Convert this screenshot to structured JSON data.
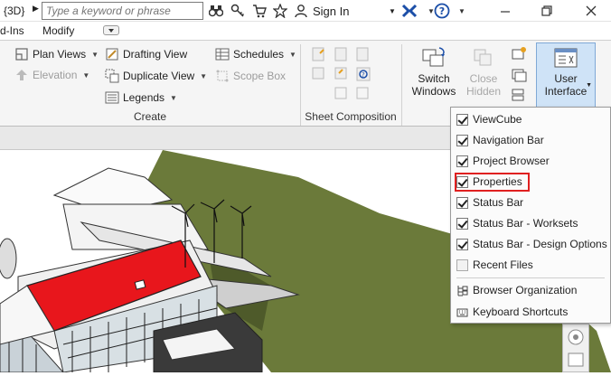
{
  "titlebar": {
    "view_name": "{3D}",
    "search_placeholder": "Type a keyword or phrase",
    "sign_in": "Sign In"
  },
  "tabs": [
    {
      "label": "d-Ins"
    },
    {
      "label": "Modify"
    }
  ],
  "ribbon": {
    "create_panel": {
      "title": "Create",
      "plan_views": "Plan Views",
      "elevation": "Elevation",
      "drafting_view": "Drafting View",
      "duplicate_view": "Duplicate View",
      "legends": "Legends",
      "schedules": "Schedules",
      "scope_box": "Scope Box"
    },
    "sheet_panel": {
      "title": "Sheet Composition"
    },
    "windows_panel": {
      "switch_windows": [
        "Switch",
        "Windows"
      ],
      "close_hidden": [
        "Close",
        "Hidden"
      ],
      "user_interface": [
        "User",
        "Interface"
      ]
    }
  },
  "user_interface_menu": {
    "items": [
      {
        "label": "ViewCube",
        "checked": true
      },
      {
        "label": "Navigation Bar",
        "checked": true
      },
      {
        "label": "Project Browser",
        "checked": true
      },
      {
        "label": "Properties",
        "checked": true
      },
      {
        "label": "Status Bar",
        "checked": true
      },
      {
        "label": "Status Bar - Worksets",
        "checked": true
      },
      {
        "label": "Status Bar - Design Options",
        "checked": true
      },
      {
        "label": "Recent Files",
        "checked": false
      }
    ],
    "actions": [
      {
        "label": "Browser Organization",
        "icon": "browser-organization-icon"
      },
      {
        "label": "Keyboard Shortcuts",
        "icon": "keyboard-shortcuts-icon"
      }
    ]
  },
  "colors": {
    "roof_red": "#e8161c",
    "ground_green": "#6b7a3a",
    "ui_button_active": "#cfe3f7",
    "highlight_red": "#e02020"
  }
}
